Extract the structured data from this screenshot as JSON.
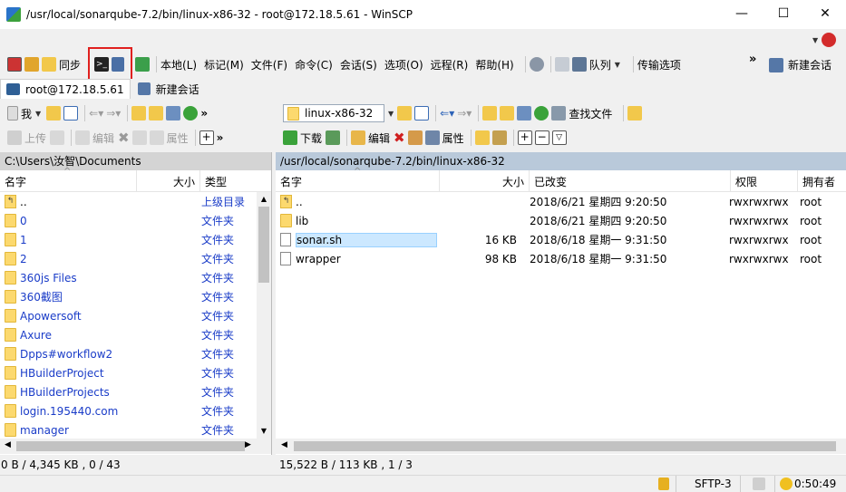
{
  "window": {
    "title": "/usr/local/sonarqube-7.2/bin/linux-x86-32 - root@172.18.5.61 - WinSCP",
    "min": "—",
    "max": "☐",
    "close": "✕"
  },
  "toolbar": {
    "sync": "同步",
    "local": "本地(L)",
    "mark": "标记(M)",
    "file": "文件(F)",
    "command": "命令(C)",
    "session": "会话(S)",
    "options": "选项(O)",
    "remote": "远程(R)",
    "help": "帮助(H)",
    "queue": "队列",
    "transfer": "传输选项",
    "new_session": "新建会话",
    "more": "»"
  },
  "tabs": {
    "session_tab": "root@172.18.5.61",
    "new_tab": "新建会话"
  },
  "left": {
    "drive": "我",
    "upload": "上传",
    "edit": "编辑",
    "props": "属性",
    "path": "C:\\Users\\汝智\\Documents",
    "col_name": "名字",
    "col_size": "大小",
    "col_type": "类型",
    "sort_arrow": "^",
    "up_type": "上级目录",
    "items": [
      {
        "name": "..",
        "type": "上级目录"
      },
      {
        "name": "0",
        "type": "文件夹"
      },
      {
        "name": "1",
        "type": "文件夹"
      },
      {
        "name": "2",
        "type": "文件夹"
      },
      {
        "name": "360js Files",
        "type": "文件夹"
      },
      {
        "name": "360截图",
        "type": "文件夹"
      },
      {
        "name": "Apowersoft",
        "type": "文件夹"
      },
      {
        "name": "Axure",
        "type": "文件夹"
      },
      {
        "name": "Dpps#workflow2",
        "type": "文件夹"
      },
      {
        "name": "HBuilderProject",
        "type": "文件夹"
      },
      {
        "name": "HBuilderProjects",
        "type": "文件夹"
      },
      {
        "name": "login.195440.com",
        "type": "文件夹"
      },
      {
        "name": "manager",
        "type": "文件夹"
      }
    ],
    "status": "0 B / 4,345 KB ,  0 / 43"
  },
  "right": {
    "dir": "linux-x86-32",
    "find": "查找文件",
    "download": "下载",
    "edit": "编辑",
    "props": "属性",
    "path": "/usr/local/sonarqube-7.2/bin/linux-x86-32",
    "col_name": "名字",
    "col_size": "大小",
    "col_changed": "已改变",
    "col_perm": "权限",
    "col_owner": "拥有者",
    "sort_arrow": "^",
    "items": [
      {
        "name": "..",
        "size": "",
        "changed": "2018/6/21 星期四 9:20:50",
        "perm": "rwxrwxrwx",
        "owner": "root"
      },
      {
        "name": "lib",
        "size": "",
        "changed": "2018/6/21 星期四 9:20:50",
        "perm": "rwxrwxrwx",
        "owner": "root"
      },
      {
        "name": "sonar.sh",
        "size": "16 KB",
        "changed": "2018/6/18 星期一 9:31:50",
        "perm": "rwxrwxrwx",
        "owner": "root"
      },
      {
        "name": "wrapper",
        "size": "98 KB",
        "changed": "2018/6/18 星期一 9:31:50",
        "perm": "rwxrwxrwx",
        "owner": "root"
      }
    ],
    "status": "15,522 B / 113 KB ,  1 / 3"
  },
  "statusbar": {
    "protocol": "SFTP-3",
    "time": "0:50:49"
  },
  "colors": {
    "highlight_border": "#e0201e",
    "remote_header": "#b9c9da",
    "link_blue": "#1a3cc8"
  }
}
